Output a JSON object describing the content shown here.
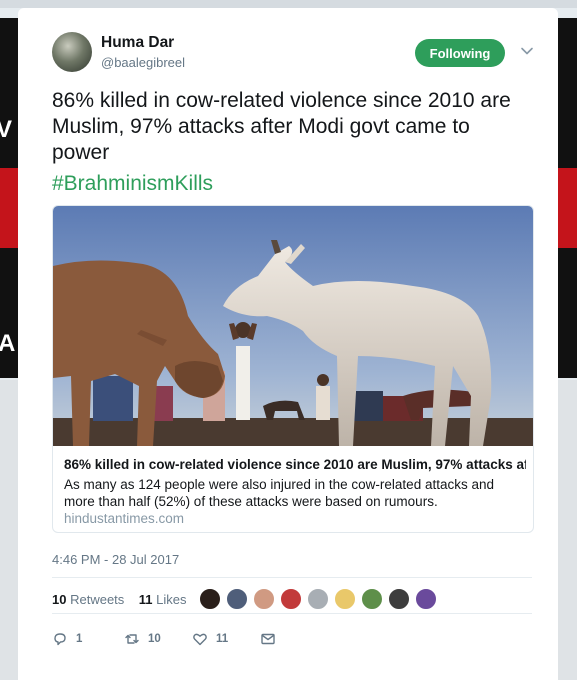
{
  "tweet": {
    "author": {
      "display_name": "Huma Dar",
      "handle": "@baalegibreel"
    },
    "follow_button_label": "Following",
    "text": "86% killed in cow-related violence since 2010 are Muslim, 97% attacks after Modi govt came to power",
    "hashtag": "#BrahminismKills",
    "link_card": {
      "title": "86% killed in cow-related violence since 2010 are Muslim, 97% attacks af...",
      "description": "As many as 124 people were also injured in the cow-related attacks and more than half (52%) of these attacks were based on rumours.",
      "domain": "hindustantimes.com"
    },
    "timestamp": "4:46 PM - 28 Jul 2017",
    "stats": {
      "retweets_count": "10",
      "retweets_label": "Retweets",
      "likes_count": "11",
      "likes_label": "Likes"
    },
    "actions": {
      "reply_count": "1",
      "retweet_count": "10",
      "like_count": "11"
    }
  },
  "colors": {
    "accent": "#2e9e5b",
    "secondary_text": "#657786",
    "background": "#e6ecf0"
  },
  "icons": [
    "caret-down-icon",
    "reply-icon",
    "retweet-icon",
    "heart-icon",
    "envelope-icon"
  ]
}
